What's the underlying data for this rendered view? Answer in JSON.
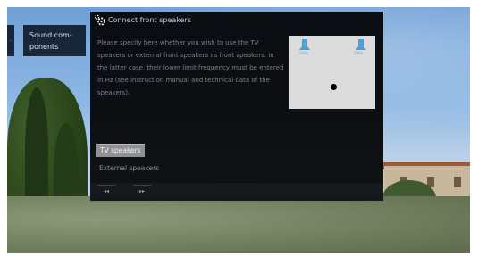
{
  "sidebar": {
    "collapsed_indicator": "..",
    "current_section": "Sound com-ponents"
  },
  "dialog": {
    "title": "Connect front speakers",
    "description": "Please specify here whether you wish to use the TV speakers or external front speakers as front speakers. In the latter case, their lower limit frequency must be entered in Hz (see instruction manual and technical data of the speakers).",
    "preview": {
      "left_speaker_label": "50Hz",
      "right_speaker_label": "50Hz",
      "speaker_color": "#4f9fd4"
    },
    "options": [
      {
        "label": "TV speakers",
        "selected": true
      },
      {
        "label": "External speakers",
        "selected": false
      }
    ],
    "footer": {
      "back_symbol": "◂◂",
      "forward_symbol": "▸▸"
    }
  }
}
